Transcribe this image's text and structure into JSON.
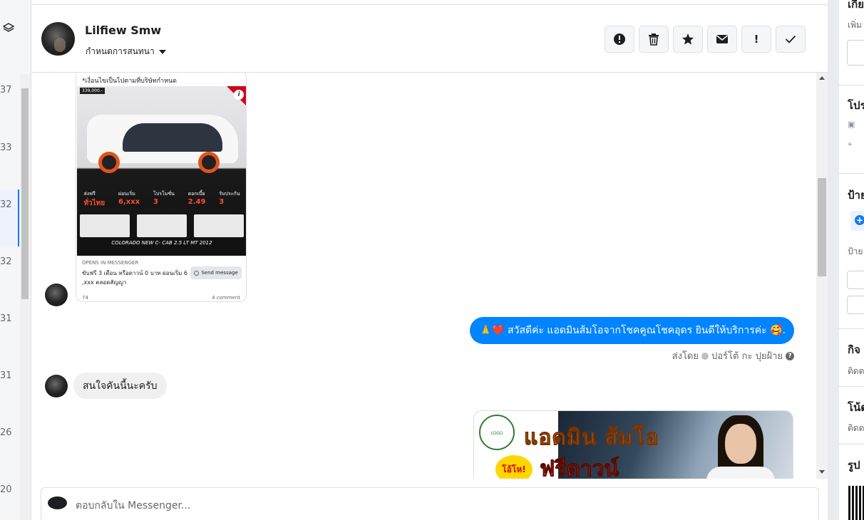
{
  "left_column": {
    "numbers": [
      "37",
      "33",
      "32",
      "32",
      "31",
      "31",
      "26",
      "20"
    ]
  },
  "header": {
    "contact_name": "Lilfiew Smw",
    "assign_label": "กำหนดการสนทนา",
    "toolbar": [
      {
        "icon": "alert-circle-icon",
        "glyph": "●"
      },
      {
        "icon": "trash-icon",
        "glyph": "🗑"
      },
      {
        "icon": "star-icon",
        "glyph": "★"
      },
      {
        "icon": "envelope-icon",
        "glyph": "✉"
      },
      {
        "icon": "exclamation-icon",
        "glyph": "!"
      },
      {
        "icon": "checkmark-icon",
        "glyph": "✓"
      }
    ]
  },
  "ad_card": {
    "caption": "*เงื่อนไขเป็นไปตามที่บริษัทกำหนด",
    "price_tag": "339,000.-",
    "stats": [
      {
        "label": "ส่งฟรี",
        "value": "ทั่วไทย"
      },
      {
        "label": "ผ่อนเริ่ม",
        "value": "6,xxx"
      },
      {
        "label": "โปรโมชั่น",
        "value": "3"
      },
      {
        "label": "ดอกเบี้ย",
        "value": "2.49"
      },
      {
        "label": "รับประกัน",
        "value": "3"
      }
    ],
    "model": "COLORADO NEW C- CAB 2.5 LT MT 2012",
    "opens_in": "OPENS IN MESSENGER",
    "body_text": "ขับฟรี 3 เดือน หรือดาวน์ 0 บาท ผ่อนเริ่ม 6 ,xxx ตลอดสัญญา",
    "send_label": "Send message",
    "reactions": "74",
    "comments": "4 comment"
  },
  "messages": {
    "outgoing_text": "🙏❤️ สวัสดีค่ะ แอดมินส้มโอจากโชคคูณโชคอุดร ยินดีให้บริการค่ะ 🥰.",
    "sent_by_prefix": "ส่งโดย",
    "sent_by_name": "ปอร์โต้ กะ ปุยฝ้าย",
    "incoming_text": "สนใจคันนี้นะครับ",
    "banner": {
      "line1": "แอดมิน  ส้มโอ",
      "line2": "ฟรีดาวน์",
      "burst": "โอ้โห!"
    }
  },
  "reply": {
    "placeholder": "ตอบกลับใน Messenger..."
  },
  "right_panel": {
    "top_heading": "เกี่ย",
    "top_sub": "เพิ่ม",
    "sections": [
      {
        "heading": "โปร"
      },
      {
        "heading": "ป้าย",
        "sub": "ป้าย"
      },
      {
        "heading": "กิจ",
        "sub": "ติดต"
      },
      {
        "heading": "โน้ต",
        "sub": "ติดต"
      },
      {
        "heading": "รูป"
      }
    ]
  },
  "colors": {
    "accent": "#1877f2",
    "bubble_out": "#0084ff",
    "bubble_in": "#f0f0f0"
  }
}
